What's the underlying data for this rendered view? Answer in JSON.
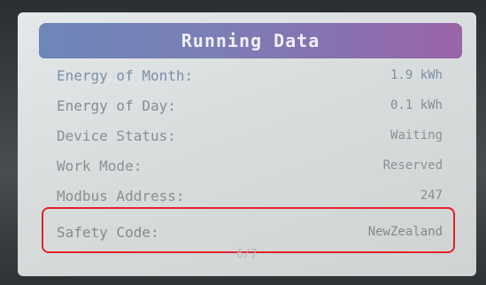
{
  "header": {
    "title": "Running Data"
  },
  "rows": [
    {
      "label": "Energy of Month:",
      "value": "1.9 kWh"
    },
    {
      "label": "Energy of Day:",
      "value": "0.1 kWh"
    },
    {
      "label": "Device Status:",
      "value": "Waiting"
    },
    {
      "label": "Work Mode:",
      "value": "Reserved"
    },
    {
      "label": "Modbus Address:",
      "value": "247"
    },
    {
      "label": "Safety Code:",
      "value": "NewZealand"
    }
  ],
  "pager": {
    "text": "6/7"
  },
  "colors": {
    "header_start": "#6f86b8",
    "header_end": "#9a65a6",
    "highlight": "#e0242a",
    "screen_bg": "#d8dcdc"
  }
}
